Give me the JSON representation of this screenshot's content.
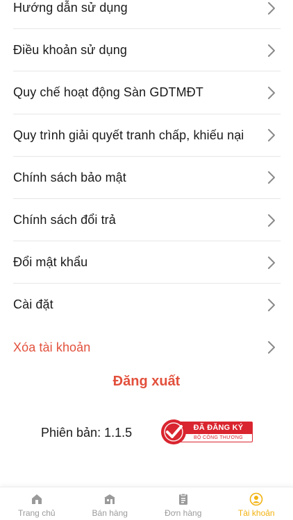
{
  "menu": {
    "items": [
      {
        "label": "Hướng dẫn sử dụng"
      },
      {
        "label": "Điều khoản sử dụng"
      },
      {
        "label": "Quy chế hoạt động Sàn GDTMĐT"
      },
      {
        "label": "Quy trình giải quyết tranh chấp, khiếu nại"
      },
      {
        "label": "Chính sách bảo mật"
      },
      {
        "label": "Chính sách đổi trả"
      },
      {
        "label": "Đổi mật khẩu"
      },
      {
        "label": "Cài đặt"
      },
      {
        "label": "Xóa tài khoản"
      }
    ]
  },
  "logout_label": "Đăng xuất",
  "version": {
    "text": "Phiên bản: 1.1.5"
  },
  "badge": {
    "line1": "ĐÃ ĐĂNG KÝ",
    "line2": "BỘ CÔNG THƯƠNG",
    "color": "#d9252f"
  },
  "tabs": [
    {
      "label": "Trang chủ",
      "icon": "home-icon"
    },
    {
      "label": "Bán hàng",
      "icon": "store-icon"
    },
    {
      "label": "Đơn hàng",
      "icon": "clipboard-icon"
    },
    {
      "label": "Tài khoản",
      "icon": "user-circle-icon",
      "active": true
    }
  ],
  "colors": {
    "accent": "#f2b20f",
    "danger": "#e2503c",
    "inactive_tab": "#9a9a9a"
  }
}
